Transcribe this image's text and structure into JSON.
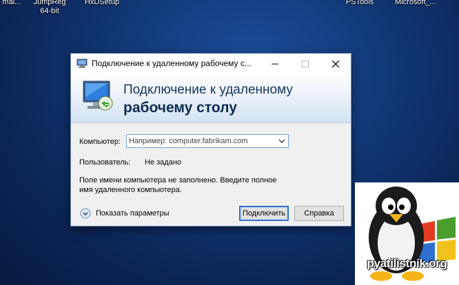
{
  "desktop": {
    "icons": [
      {
        "label": "mal..."
      },
      {
        "label": "JumpReg 64-bit"
      },
      {
        "label": "HxDSetup"
      },
      {
        "label": "PSTools"
      },
      {
        "label": "Microsoft_..."
      }
    ]
  },
  "dialog": {
    "title": "Подключение к удаленному рабочему с...",
    "banner_line1": "Подключение к удаленному",
    "banner_line2": "рабочему столу",
    "computer_label": "Компьютер:",
    "computer_placeholder": "Например: computer.fabrikam.com",
    "computer_value": "",
    "user_label": "Пользователь:",
    "user_value": "Не задано",
    "hint": "Поле имени компьютера не заполнено. Введите полное имя удаленного компьютера.",
    "show_params": "Показать параметры",
    "connect_button": "Подключить",
    "help_button": "Справка"
  },
  "watermark": {
    "text": "pyatilistnik.org"
  }
}
